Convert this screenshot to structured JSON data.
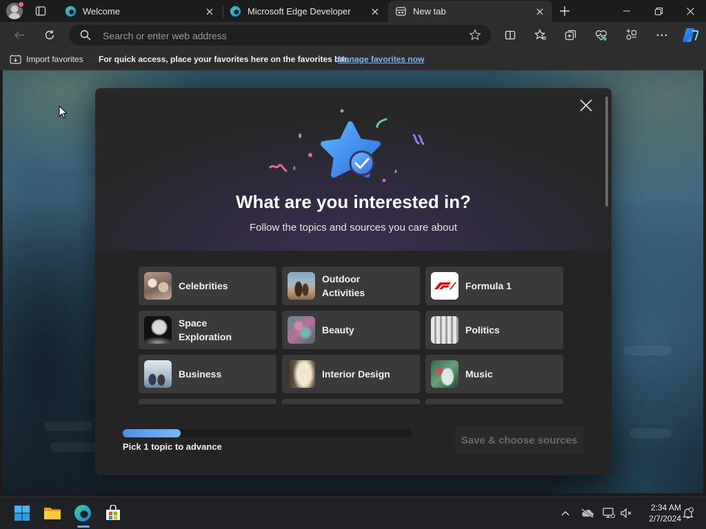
{
  "tabs": [
    {
      "title": "Welcome",
      "favicon": "edge-icon",
      "active": false
    },
    {
      "title": "Microsoft Edge Developer",
      "favicon": "edge-icon",
      "active": false
    },
    {
      "title": "New tab",
      "favicon": "new-tab-page-icon",
      "active": true
    }
  ],
  "toolbar": {
    "address_placeholder": "Search or enter web address"
  },
  "favorites_bar": {
    "import_label": "Import favorites",
    "message": "For quick access, place your favorites here on the favorites bar.",
    "manage_link": "Manage favorites now"
  },
  "modal": {
    "title": "What are you interested in?",
    "subtitle": "Follow the topics and sources you care about",
    "topics": [
      {
        "label": "Celebrities"
      },
      {
        "label": "Outdoor Activities"
      },
      {
        "label": "Formula 1"
      },
      {
        "label": "Space Exploration"
      },
      {
        "label": "Beauty"
      },
      {
        "label": "Politics"
      },
      {
        "label": "Business"
      },
      {
        "label": "Interior Design"
      },
      {
        "label": "Music"
      }
    ],
    "progress_fraction": 0.2,
    "progress_label": "Pick 1 topic to advance",
    "save_button": "Save & choose sources"
  },
  "taskbar": {
    "time": "2:34 AM",
    "date": "2/7/2024",
    "apps": [
      "windows-start-icon",
      "file-explorer-icon",
      "edge-icon",
      "microsoft-store-icon"
    ]
  },
  "colors": {
    "accent": "#4f8fe6",
    "link": "#79b8f2",
    "f1_red": "#e10600"
  }
}
